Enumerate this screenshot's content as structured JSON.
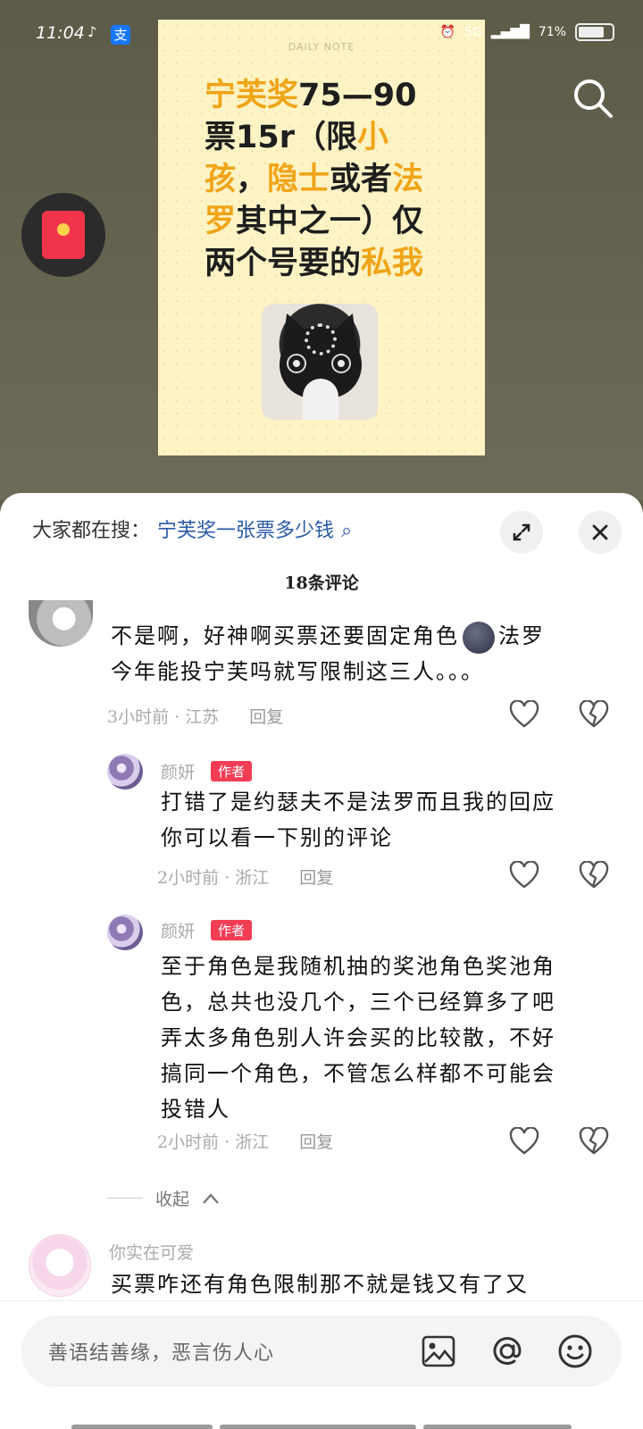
{
  "status": {
    "time": "11:04",
    "tiktok": "♪",
    "alipay": "支",
    "signal": "5G",
    "battery": "71%"
  },
  "post": {
    "note": "DAILY NOTE",
    "line1_a": "宁芙奖",
    "line1_b": "75—90",
    "line2_a": "票15r（限",
    "line2_b": "小",
    "line3_a": "孩",
    "line3_b": "，",
    "line3_c": "隐士",
    "line3_d": "或者",
    "line3_e": "法",
    "line4_a": "罗",
    "line4_b": "其中之一）仅",
    "line5_a": "两个号要的",
    "line5_b": "私我"
  },
  "sheet": {
    "hot_label": "大家都在搜：",
    "hot_query": "宁芙奖一张票多少钱",
    "comment_count": "18条评论"
  },
  "comments": [
    {
      "text1": "不是啊，好神啊买票还要固定角色",
      "text1b": "法罗",
      "text2": "今年能投宁芙吗就写限制这三人。。。",
      "meta": "3小时前 · 江苏",
      "reply": "回复"
    },
    {
      "user": "颜妍",
      "badge": "作者",
      "text1": "打错了是约瑟夫不是法罗而且我的回应",
      "text2": "你可以看一下别的评论",
      "meta": "2小时前 · 浙江",
      "reply": "回复"
    },
    {
      "user": "颜妍",
      "badge": "作者",
      "text1": "至于角色是我随机抽的奖池角色奖池角",
      "text2": "色，总共也没几个，三个已经算多了吧",
      "text3": "弄太多角色别人许会买的比较散，不好",
      "text4": "搞同一个角色，不管怎么样都不可能会",
      "text5": "投错人",
      "meta": "2小时前 · 浙江",
      "reply": "回复"
    },
    {
      "user": "你实在可爱",
      "text1": "买票咋还有角色限制那不就是钱又有了又"
    }
  ],
  "collapse": "收起",
  "input_placeholder": "善语结善缘，恶言伤人心",
  "colors": {
    "accent": "#f0a417",
    "badge": "#f23d55",
    "link": "#2a5aa8"
  }
}
